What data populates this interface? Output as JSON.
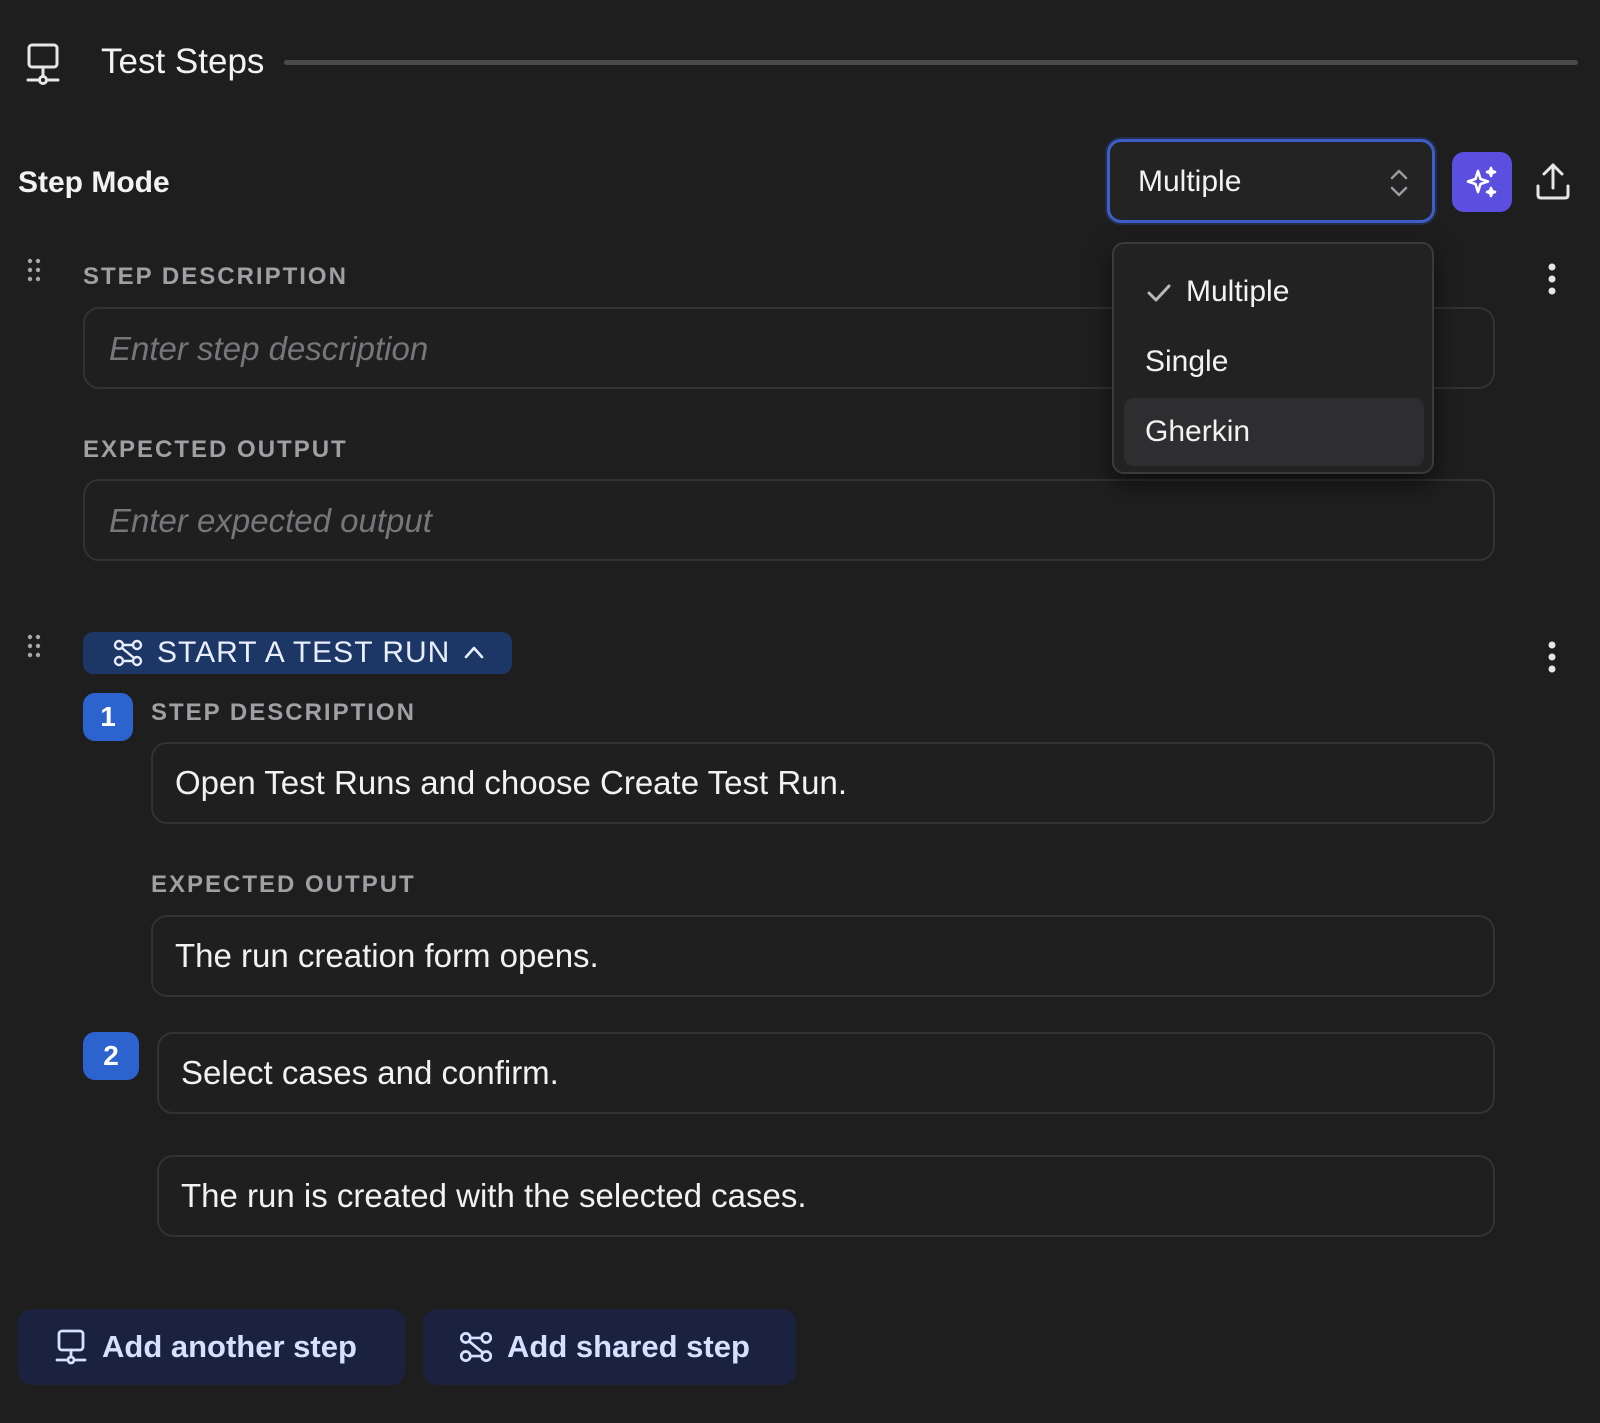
{
  "header": {
    "title": "Test Steps",
    "icon": "monitor-icon"
  },
  "step_mode": {
    "label": "Step Mode",
    "selected": "Multiple",
    "options": [
      "Multiple",
      "Single",
      "Gherkin"
    ],
    "ai_button_icon": "sparkles-icon",
    "upload_icon": "upload-icon"
  },
  "step_1": {
    "description_label": "STEP DESCRIPTION",
    "description_placeholder": "Enter step description",
    "output_label": "EXPECTED OUTPUT",
    "output_placeholder": "Enter expected output"
  },
  "shared_step": {
    "title": "START A TEST RUN",
    "icon": "shared-step-icon",
    "substeps": [
      {
        "number": "1",
        "description_label": "STEP DESCRIPTION",
        "description": "Open Test Runs and choose Create Test Run.",
        "output_label": "EXPECTED OUTPUT",
        "output": "The run creation form opens."
      },
      {
        "number": "2",
        "description": "Select cases and confirm.",
        "output": "The run is created with the selected cases."
      }
    ]
  },
  "actions": {
    "add_step": "Add another step",
    "add_shared_step": "Add shared step"
  },
  "colors": {
    "background": "#1e1e1f",
    "accent_purple": "#5b4fe0",
    "badge_blue": "#2d63cf",
    "chip_blue": "#1c3666",
    "select_border": "#3d5ec8"
  }
}
